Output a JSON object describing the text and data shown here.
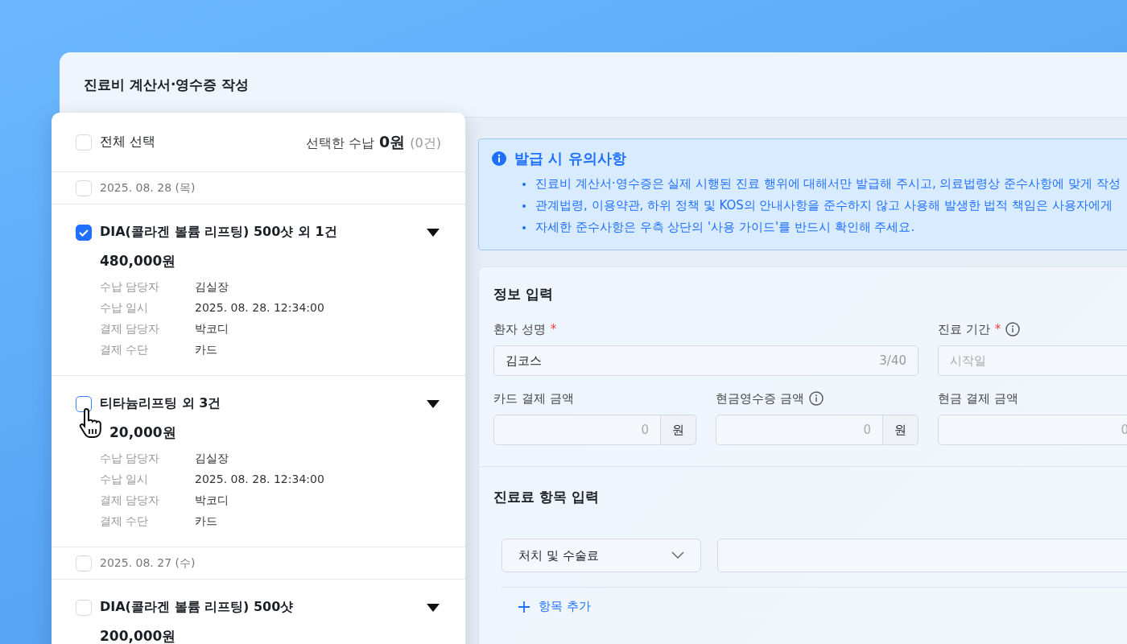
{
  "window": {
    "title": "진료비 계산서·영수증 작성"
  },
  "payment_list": {
    "select_all": {
      "label": "전체 선택",
      "checked": false
    },
    "summary": {
      "label": "선택한 수납",
      "amount": "0원",
      "count": "(0건)"
    },
    "groups": [
      {
        "date": "2025. 08. 28 (목)",
        "checked": false,
        "items": [
          {
            "title": "DIA(콜라겐 볼륨 리프팅) 500샷 외 1건",
            "checked": true,
            "amount": "480,000원",
            "details": [
              {
                "label": "수납 담당자",
                "value": "김실장"
              },
              {
                "label": "수납 일시",
                "value": "2025. 08. 28. 12:34:00"
              },
              {
                "label": "결제 담당자",
                "value": "박코디"
              },
              {
                "label": "결제 수단",
                "value": "카드"
              }
            ]
          },
          {
            "title": "티타늄리프팅 외 3건",
            "checked": false,
            "hovered": true,
            "amount": "20,000원",
            "details": [
              {
                "label": "수납 담당자",
                "value": "김실장"
              },
              {
                "label": "수납 일시",
                "value": "2025. 08. 28. 12:34:00"
              },
              {
                "label": "결제 담당자",
                "value": "박코디"
              },
              {
                "label": "결제 수단",
                "value": "카드"
              }
            ]
          }
        ]
      },
      {
        "date": "2025. 08. 27 (수)",
        "checked": false,
        "items": [
          {
            "title": "DIA(콜라겐 볼륨 리프팅) 500샷",
            "checked": false,
            "amount": "200,000원"
          }
        ]
      }
    ]
  },
  "notice": {
    "title": "발급 시 유의사항",
    "items": [
      "진료비 계산서·영수증은 실제 시행된 진료 행위에 대해서만 발급해 주시고, 의료법령상 준수사항에 맞게 작성",
      "관계법령, 이용약관, 하위 정책 및 KOS의 안내사항을 준수하지 않고 사용해 발생한 법적 책임은 사용자에게",
      "자세한 준수사항은 우측 상단의 '사용 가이드'를 반드시 확인해 주세요."
    ]
  },
  "info_form": {
    "title": "정보 입력",
    "fields": [
      {
        "kind": "text",
        "label": "환자 성명",
        "required_mark": "*",
        "value": "김코스",
        "counter": "3/40"
      },
      {
        "kind": "date",
        "label": "진료 기간",
        "required_mark": "*",
        "info": true,
        "placeholder": "시작일"
      },
      {
        "kind": "amount",
        "label": "카드 결제 금액",
        "placeholder": "0",
        "unit": "원"
      },
      {
        "kind": "amount",
        "label": "현금영수증 금액",
        "info": true,
        "placeholder": "0",
        "unit": "원"
      },
      {
        "kind": "amount",
        "label": "현금 결제 금액",
        "placeholder": "0"
      }
    ]
  },
  "fee_items": {
    "title": "진료료 항목 입력",
    "rows": [
      {
        "category": "처치 및 수술료"
      }
    ],
    "add_button": "항목 추가"
  }
}
